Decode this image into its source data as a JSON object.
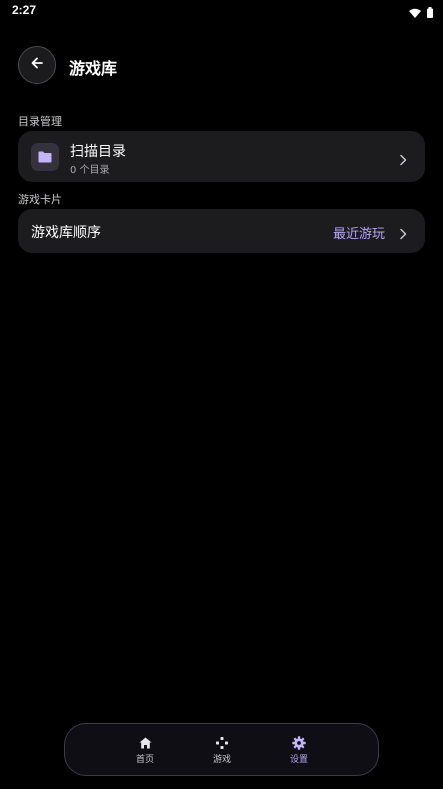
{
  "status_bar": {
    "time": "2:27",
    "icons": [
      "wifi-icon",
      "battery-icon"
    ]
  },
  "header": {
    "back_icon": "arrow-left-icon",
    "title": "游戏库"
  },
  "sections": {
    "directory": {
      "label": "目录管理",
      "scan": {
        "icon": "folder-icon",
        "title": "扫描目录",
        "subtitle": "0 个目录"
      }
    },
    "game_card": {
      "label": "游戏卡片",
      "order": {
        "title": "游戏库顺序",
        "value": "最近游玩"
      }
    }
  },
  "bottom_nav": {
    "items": [
      {
        "icon": "home-icon",
        "label": "首页",
        "active": false
      },
      {
        "icon": "gamepad-icon",
        "label": "游戏",
        "active": false
      },
      {
        "icon": "gear-icon",
        "label": "设置",
        "active": true
      }
    ]
  },
  "colors": {
    "background": "#000000",
    "card": "#1c1c1f",
    "accent": "#b8a6f4",
    "nav_border": "#3d3b4a"
  }
}
